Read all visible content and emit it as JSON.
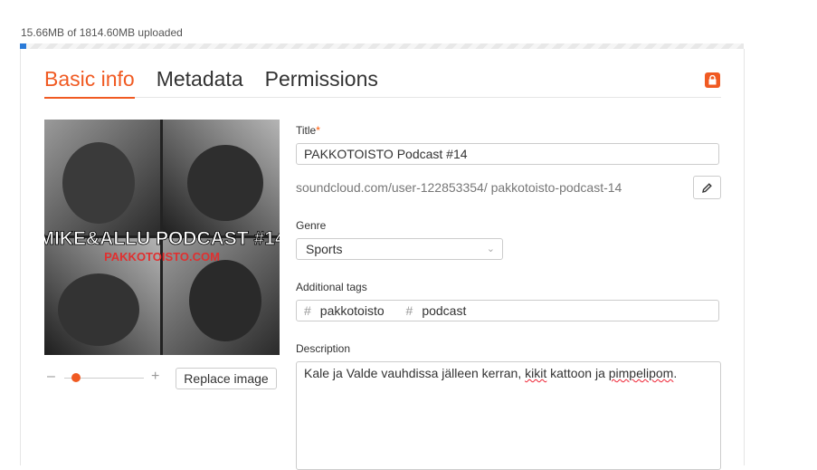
{
  "upload": {
    "status": "15.66MB of 1814.60MB uploaded",
    "progress_fraction": 0.0086
  },
  "tabs": [
    {
      "label": "Basic info",
      "active": true
    },
    {
      "label": "Metadata",
      "active": false
    },
    {
      "label": "Permissions",
      "active": false
    }
  ],
  "lock_icon": "lock-icon",
  "artwork": {
    "title_line": "MIKE&ALLU PODCAST #14",
    "site_line": "PAKKOTOISTO.COM",
    "zoom_level_fraction": 0.1
  },
  "replace_image_label": "Replace image",
  "form": {
    "title_label": "Title",
    "title_required_mark": "*",
    "title_value": "PAKKOTOISTO Podcast #14",
    "permalink": "soundcloud.com/user-122853354/ pakkotoisto-podcast-14",
    "genre_label": "Genre",
    "genre_value": "Sports",
    "tags_label": "Additional tags",
    "tags": [
      "pakkotoisto",
      "podcast"
    ],
    "description_label": "Description",
    "description_parts": [
      "Kale ja Valde vauhdissa jälleen kerran, ",
      "kikit",
      " kattoon ja ",
      "pimpelipom",
      "."
    ]
  },
  "colors": {
    "accent": "#f05a22",
    "progress": "#2b7bd8"
  }
}
